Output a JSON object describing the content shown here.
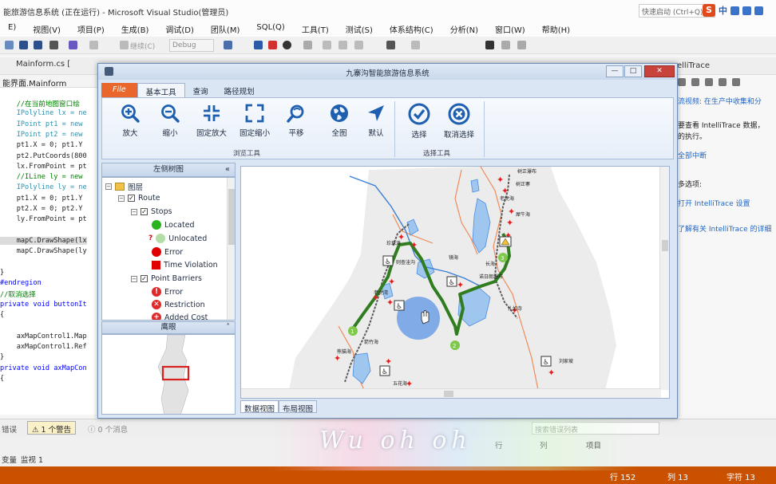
{
  "vs": {
    "title": "能旅游信息系统 (正在运行) - Microsoft Visual Studio(管理员)",
    "quick_launch": "快速启动 (Ctrl+Q)",
    "ime_label": "中",
    "menu": [
      "E)",
      "视图(V)",
      "项目(P)",
      "生成(B)",
      "调试(D)",
      "团队(M)",
      "SQL(Q)",
      "工具(T)",
      "测试(S)",
      "体系结构(C)",
      "分析(N)",
      "窗口(W)",
      "帮助(H)"
    ],
    "toolbar": {
      "continue_label": "继续(C)",
      "config": "Debug"
    },
    "doc_tab": "Mainform.cs [",
    "intelli_tab": "elliTrace",
    "code_header": "能界面.Mainform",
    "code_lines": [
      {
        "text": "    //在当前地图窗口绘",
        "cls": "cm"
      },
      {
        "text": "    IPolyline lx = ne",
        "cls": "ty"
      },
      {
        "text": "    IPoint pt1 = new",
        "cls": "ty"
      },
      {
        "text": "    IPoint pt2 = new",
        "cls": "ty"
      },
      {
        "text": "    pt1.X = 0; pt1.Y",
        "cls": ""
      },
      {
        "text": "    pt2.PutCoords(800",
        "cls": ""
      },
      {
        "text": "    lx.FromPoint = pt",
        "cls": ""
      },
      {
        "text": "    //ILine ly = new",
        "cls": "cm"
      },
      {
        "text": "    IPolyline ly = ne",
        "cls": "ty"
      },
      {
        "text": "    pt1.X = 0; pt1.Y",
        "cls": ""
      },
      {
        "text": "    pt2.X = 0; pt2.Y",
        "cls": ""
      },
      {
        "text": "    ly.FromPoint = pt",
        "cls": ""
      },
      {
        "text": "",
        "cls": ""
      },
      {
        "text": "    mapC.DrawShape(lx",
        "cls": "hl"
      },
      {
        "text": "    mapC.DrawShape(ly",
        "cls": ""
      },
      {
        "text": "",
        "cls": ""
      },
      {
        "text": "}",
        "cls": ""
      },
      {
        "text": "#endregion",
        "cls": "kw"
      },
      {
        "text": "//取消选择",
        "cls": "cm"
      },
      {
        "text": "private void buttonIt",
        "cls": "kw"
      },
      {
        "text": "{",
        "cls": ""
      },
      {
        "text": "",
        "cls": ""
      },
      {
        "text": "    axMapControl1.Map",
        "cls": ""
      },
      {
        "text": "    axMapControl1.Ref",
        "cls": ""
      },
      {
        "text": "}",
        "cls": ""
      },
      {
        "text": "private void axMapCon",
        "cls": "kw"
      },
      {
        "text": "{",
        "cls": ""
      }
    ],
    "intelli": [
      {
        "text": "流视频: 在生产中收集和分",
        "link": true
      },
      {
        "text": "要查看 IntelliTrace 数据，",
        "link": false
      },
      {
        "text": "的执行。",
        "link": false
      },
      {
        "text": "全部中断",
        "link": true
      },
      {
        "text": "多选项:",
        "link": false
      },
      {
        "text": "打开 IntelliTrace 设置",
        "link": true
      },
      {
        "text": "了解有关 IntelliTrace 的详细",
        "link": true
      }
    ],
    "error_list": {
      "errors_label": "错误",
      "warnings": "1 个警告",
      "messages": "0 个消息",
      "search_placeholder": "搜索错误列表",
      "col_row": "行",
      "col_col": "列",
      "col_project": "项目"
    },
    "bottom_tabs": [
      "变量",
      "监视 1"
    ],
    "status": {
      "line": "行 152",
      "col": "列 13",
      "char": "字符 13"
    },
    "subtitle": "Wu oh oh"
  },
  "app": {
    "title": "九寨沟智能旅游信息系统",
    "ribbon_tabs": [
      "File",
      "基本工具",
      "查询",
      "路径规划"
    ],
    "buttons": [
      {
        "label": "放大",
        "icon": "zoom-in-icon"
      },
      {
        "label": "缩小",
        "icon": "zoom-out-icon"
      },
      {
        "label": "固定放大",
        "icon": "fixed-zoom-in-icon"
      },
      {
        "label": "固定缩小",
        "icon": "fixed-zoom-out-icon"
      },
      {
        "label": "平移",
        "icon": "pan-icon"
      },
      {
        "label": "全图",
        "icon": "globe-icon"
      },
      {
        "label": "默认",
        "icon": "arrow-cursor-icon"
      },
      {
        "label": "选择",
        "icon": "select-check-icon"
      },
      {
        "label": "取消选择",
        "icon": "clear-select-icon"
      }
    ],
    "group_browse": "浏览工具",
    "group_select": "选择工具",
    "toc_title": "左侧树图",
    "toc": {
      "layers": "图层",
      "route": "Route",
      "stops": "Stops",
      "located": "Located",
      "unlocated": "Unlocated",
      "error": "Error",
      "time_violation": "Time Violation",
      "point_barriers": "Point Barriers",
      "pb_error": "Error",
      "restriction": "Restriction",
      "added_cost": "Added Cost"
    },
    "eagle_title": "鹰眼",
    "view_tabs": [
      "数据视图",
      "布局视图"
    ],
    "map_labels": [
      "树正瀑布",
      "树正寨",
      "老虎海",
      "犀牛海",
      "镜海",
      "五花海",
      "老虎湾",
      "珍珠滩",
      "长海",
      "则查洼沟",
      "诺日朗瀑布",
      "熊猫海",
      "箭竹海",
      "扎如寺",
      "刘家坡"
    ],
    "colors": {
      "route": "#2f7d1f",
      "river": "#3a7fd5",
      "road": "#5c5c5c",
      "lake": "#9ec6ef",
      "land": "#ececec",
      "boundary": "#f08a5a",
      "highlight": "#6fa0e6"
    }
  }
}
